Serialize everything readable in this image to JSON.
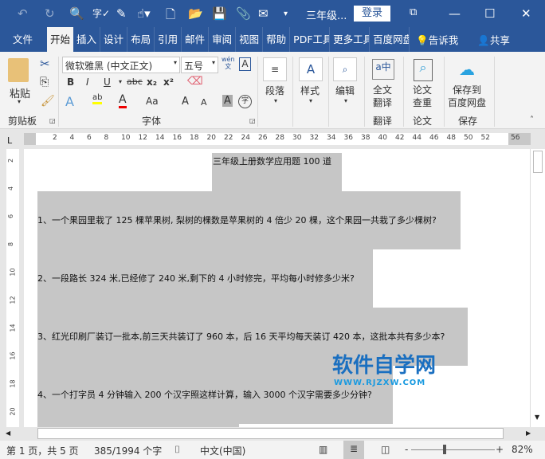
{
  "titlebar": {
    "doc_title": "三年级...",
    "login": "登录",
    "icons": [
      "undo-icon",
      "redo-icon",
      "print-preview-icon",
      "spell-check-icon",
      "edit-icon",
      "touch-mode-icon",
      "new-icon",
      "open-icon",
      "save-icon",
      "attach-icon",
      "email-icon",
      "customize-icon"
    ]
  },
  "tabs": [
    "文件",
    "开始",
    "插入",
    "设计",
    "布局",
    "引用",
    "邮件",
    "审阅",
    "视图",
    "帮助",
    "PDF工具",
    "更多工具",
    "百度网盘"
  ],
  "tell_me": "告诉我",
  "share": "共享",
  "ribbon": {
    "paste": "粘贴",
    "clipboard": "剪贴板",
    "font_name": "微软雅黑 (中文正文)",
    "font_size": "五号",
    "font_group": "字体",
    "wen": "wén",
    "wen2": "文",
    "bold": "B",
    "italic": "I",
    "underline": "U",
    "strike": "abc",
    "sub": "x₂",
    "sup": "x²",
    "text_effect": "A",
    "highlight": "ab",
    "font_color": "A",
    "case": "Aa",
    "grow": "A",
    "shrink": "A",
    "shade": "A",
    "enclose": "字",
    "paragraph": "段落",
    "styles": "样式",
    "editing": "编辑",
    "translate_btn": [
      "全文",
      "翻译"
    ],
    "translate_group": "翻译",
    "paper_btn": [
      "论文",
      "查重"
    ],
    "paper_group": "论文",
    "save_btn": [
      "保存到",
      "百度网盘"
    ],
    "save_group": "保存"
  },
  "ruler": {
    "ticks": [
      "2",
      "4",
      "6",
      "8",
      "10",
      "12",
      "14",
      "16",
      "18",
      "20",
      "22",
      "24",
      "26",
      "28",
      "30",
      "32",
      "34",
      "36",
      "38",
      "40",
      "42",
      "44",
      "46",
      "48",
      "50",
      "52",
      "56"
    ],
    "vticks": [
      "2",
      "4",
      "6",
      "8",
      "10",
      "12",
      "14",
      "16",
      "18",
      "20"
    ]
  },
  "document": {
    "title": "三年级上册数学应用题 100 道",
    "questions": [
      "1、一个果园里栽了 125 棵苹果树, 梨树的棵数是苹果树的 4 倍少 20 棵，这个果园一共栽了多少棵树?",
      "2、一段路长 324 米,已经修了 240 米,剩下的 4 小时修完，平均每小时修多少米?",
      "3、红光印刷厂装订一批本,前三天共装订了 960 本，后 16 天平均每天装订 420 本，这批本共有多少本?",
      "4、一个打字员 4 分钟输入 200 个汉字照这样计算，输入 3000 个汉字需要多少分钟?"
    ],
    "watermark": "软件自学网",
    "watermark_url": "WWW.RJZXW.COM"
  },
  "status": {
    "page": "第 1 页，共 5 页",
    "words": "385/1994 个字",
    "lang": "中文(中国)",
    "zoom": "82%"
  },
  "colors": {
    "accent": "#2b579a",
    "selection": "#c6c6c6",
    "watermark": "#1a6fc0"
  }
}
